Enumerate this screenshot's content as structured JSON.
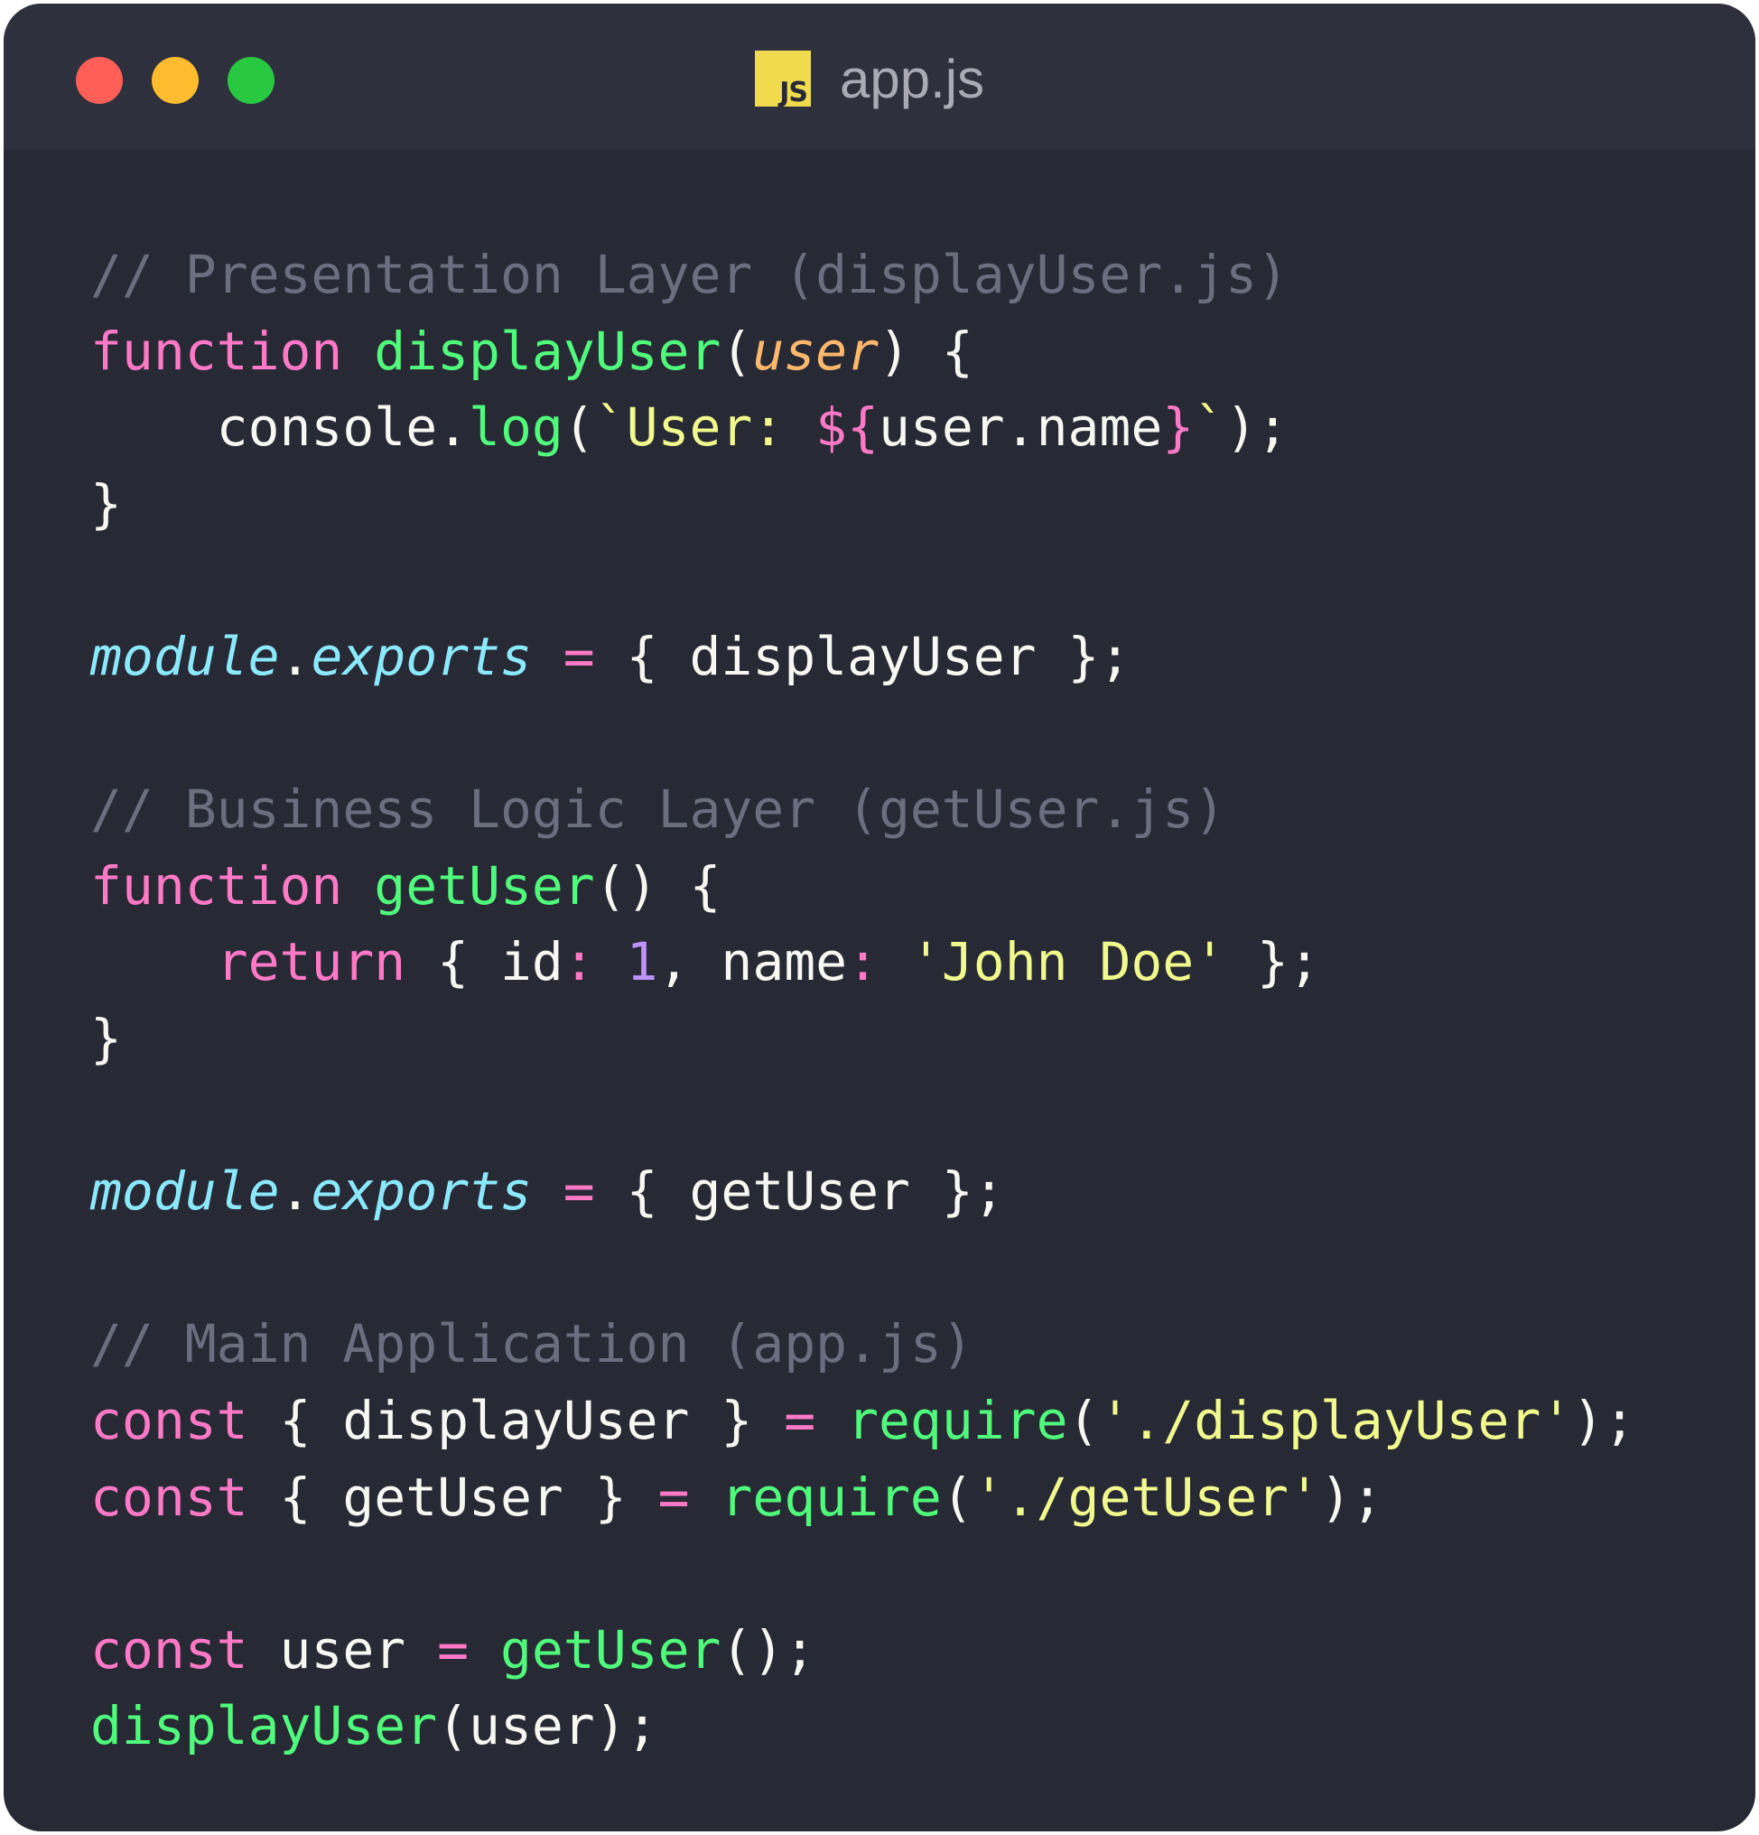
{
  "window": {
    "title": "app.js",
    "file_icon": "js-file-icon",
    "file_icon_text": "JS",
    "controls": {
      "close_color": "#ff5f57",
      "minimize_color": "#febc2e",
      "zoom_color": "#28c840"
    }
  },
  "colors": {
    "background": "#272935",
    "titlebar": "#2e303d",
    "comment": "#6b6e7f",
    "keyword": "#ff79c6",
    "function": "#50fa7b",
    "parameter": "#ffb86c",
    "string": "#f1fa8c",
    "number": "#bd93f9",
    "object": "#8be9fd",
    "text": "#f8f8f2"
  },
  "code": {
    "lines": [
      [
        {
          "t": "// Presentation Layer (displayUser.js)",
          "c": "comment"
        }
      ],
      [
        {
          "t": "function",
          "c": "kw"
        },
        {
          "t": " ",
          "c": "plain"
        },
        {
          "t": "displayUser",
          "c": "fn"
        },
        {
          "t": "(",
          "c": "plain"
        },
        {
          "t": "user",
          "c": "param"
        },
        {
          "t": ") {",
          "c": "plain"
        }
      ],
      [
        {
          "t": "    console.",
          "c": "plain"
        },
        {
          "t": "log",
          "c": "fn"
        },
        {
          "t": "(",
          "c": "plain"
        },
        {
          "t": "`User: ",
          "c": "str"
        },
        {
          "t": "${",
          "c": "kw"
        },
        {
          "t": "user.name",
          "c": "plain"
        },
        {
          "t": "}",
          "c": "kw"
        },
        {
          "t": "`",
          "c": "str"
        },
        {
          "t": ");",
          "c": "plain"
        }
      ],
      [
        {
          "t": "}",
          "c": "plain"
        }
      ],
      [],
      [
        {
          "t": "module",
          "c": "obj"
        },
        {
          "t": ".",
          "c": "plain"
        },
        {
          "t": "exports",
          "c": "obj"
        },
        {
          "t": " ",
          "c": "plain"
        },
        {
          "t": "=",
          "c": "op"
        },
        {
          "t": " { displayUser };",
          "c": "plain"
        }
      ],
      [],
      [
        {
          "t": "// Business Logic Layer (getUser.js)",
          "c": "comment"
        }
      ],
      [
        {
          "t": "function",
          "c": "kw"
        },
        {
          "t": " ",
          "c": "plain"
        },
        {
          "t": "getUser",
          "c": "fn"
        },
        {
          "t": "() {",
          "c": "plain"
        }
      ],
      [
        {
          "t": "    ",
          "c": "plain"
        },
        {
          "t": "return",
          "c": "kw"
        },
        {
          "t": " { id",
          "c": "plain"
        },
        {
          "t": ":",
          "c": "op"
        },
        {
          "t": " ",
          "c": "plain"
        },
        {
          "t": "1",
          "c": "num"
        },
        {
          "t": ", name",
          "c": "plain"
        },
        {
          "t": ":",
          "c": "op"
        },
        {
          "t": " ",
          "c": "plain"
        },
        {
          "t": "'John Doe'",
          "c": "str"
        },
        {
          "t": " };",
          "c": "plain"
        }
      ],
      [
        {
          "t": "}",
          "c": "plain"
        }
      ],
      [],
      [
        {
          "t": "module",
          "c": "obj"
        },
        {
          "t": ".",
          "c": "plain"
        },
        {
          "t": "exports",
          "c": "obj"
        },
        {
          "t": " ",
          "c": "plain"
        },
        {
          "t": "=",
          "c": "op"
        },
        {
          "t": " { getUser };",
          "c": "plain"
        }
      ],
      [],
      [
        {
          "t": "// Main Application (app.js)",
          "c": "comment"
        }
      ],
      [
        {
          "t": "const",
          "c": "kw"
        },
        {
          "t": " { displayUser } ",
          "c": "plain"
        },
        {
          "t": "=",
          "c": "op"
        },
        {
          "t": " ",
          "c": "plain"
        },
        {
          "t": "require",
          "c": "fn"
        },
        {
          "t": "(",
          "c": "plain"
        },
        {
          "t": "'./displayUser'",
          "c": "str"
        },
        {
          "t": ");",
          "c": "plain"
        }
      ],
      [
        {
          "t": "const",
          "c": "kw"
        },
        {
          "t": " { getUser } ",
          "c": "plain"
        },
        {
          "t": "=",
          "c": "op"
        },
        {
          "t": " ",
          "c": "plain"
        },
        {
          "t": "require",
          "c": "fn"
        },
        {
          "t": "(",
          "c": "plain"
        },
        {
          "t": "'./getUser'",
          "c": "str"
        },
        {
          "t": ");",
          "c": "plain"
        }
      ],
      [],
      [
        {
          "t": "const",
          "c": "kw"
        },
        {
          "t": " user ",
          "c": "plain"
        },
        {
          "t": "=",
          "c": "op"
        },
        {
          "t": " ",
          "c": "plain"
        },
        {
          "t": "getUser",
          "c": "fn"
        },
        {
          "t": "();",
          "c": "plain"
        }
      ],
      [
        {
          "t": "displayUser",
          "c": "fn"
        },
        {
          "t": "(user);",
          "c": "plain"
        }
      ]
    ]
  }
}
